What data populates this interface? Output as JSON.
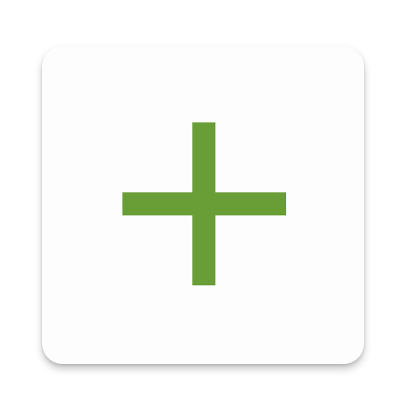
{
  "app_icon": {
    "tile_color": "#fdfdfd",
    "glyph": "plus-icon",
    "glyph_color": "#699e37"
  }
}
